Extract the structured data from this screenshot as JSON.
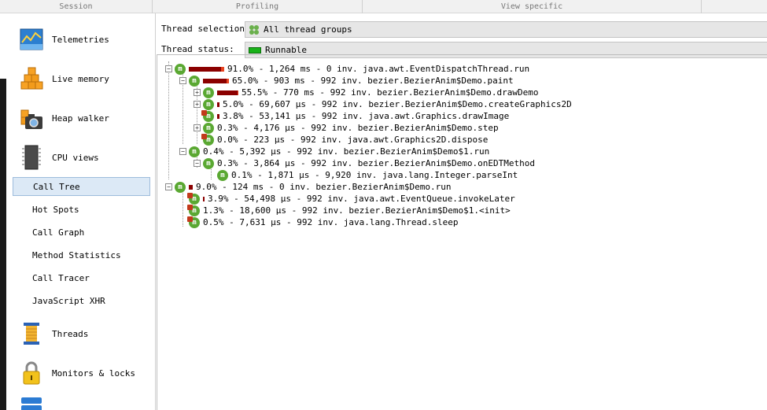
{
  "topbar": {
    "session": "Session",
    "profiling": "Profiling",
    "view_specific": "View specific"
  },
  "sidebar": {
    "items": [
      {
        "label": "Telemetries",
        "icon": "telemetries-icon"
      },
      {
        "label": "Live memory",
        "icon": "live-memory-icon"
      },
      {
        "label": "Heap walker",
        "icon": "heap-walker-icon"
      },
      {
        "label": "CPU views",
        "icon": "cpu-views-icon"
      },
      {
        "label": "Threads",
        "icon": "threads-icon"
      },
      {
        "label": "Monitors & locks",
        "icon": "monitors-locks-icon"
      }
    ],
    "cpu_subitems": [
      "Call Tree",
      "Hot Spots",
      "Call Graph",
      "Method Statistics",
      "Call Tracer",
      "JavaScript XHR"
    ],
    "selected_subitem": "Call Tree"
  },
  "filters": {
    "thread_selection_label": "Thread selection:",
    "thread_selection_value": "All thread groups",
    "thread_status_label": "Thread status:",
    "thread_status_value": "Runnable"
  },
  "tree": [
    "91.0% - 1,264 ms - 0 inv. java.awt.EventDispatchThread.run",
    "65.0% - 903 ms - 992 inv. bezier.BezierAnim$Demo.paint",
    "55.5% - 770 ms - 992 inv. bezier.BezierAnim$Demo.drawDemo",
    "5.0% - 69,607 µs - 992 inv. bezier.BezierAnim$Demo.createGraphics2D",
    "3.8% - 53,141 µs - 992 inv. java.awt.Graphics.drawImage",
    "0.3% - 4,176 µs - 992 inv. bezier.BezierAnim$Demo.step",
    "0.0% - 223 µs - 992 inv. java.awt.Graphics2D.dispose",
    "0.4% - 5,392 µs - 992 inv. bezier.BezierAnim$Demo$1.run",
    "0.3% - 3,864 µs - 992 inv. bezier.BezierAnim$Demo.onEDTMethod",
    "0.1% - 1,871 µs - 9,920 inv. java.lang.Integer.parseInt",
    "9.0% - 124 ms - 0 inv. bezier.BezierAnim$Demo.run",
    "3.9% - 54,498 µs - 992 inv. java.awt.EventQueue.invokeLater",
    "1.3% - 18,600 µs - 992 inv. bezier.BezierAnim$Demo$1.<init>",
    "0.5% - 7,631 µs - 992 inv. java.lang.Thread.sleep"
  ],
  "tree_fractions": [
    0.91,
    0.65,
    0.555,
    0.05,
    0.038,
    0.003,
    0.0,
    0.004,
    0.003,
    0.001,
    0.09,
    0.039,
    0.013,
    0.005
  ],
  "colors": {
    "bar_dark": "#8b0000",
    "bar_light": "#e8431f",
    "method_green": "#5aa832",
    "selection_bg": "#dce9f6",
    "runnable_green": "#19b219"
  }
}
